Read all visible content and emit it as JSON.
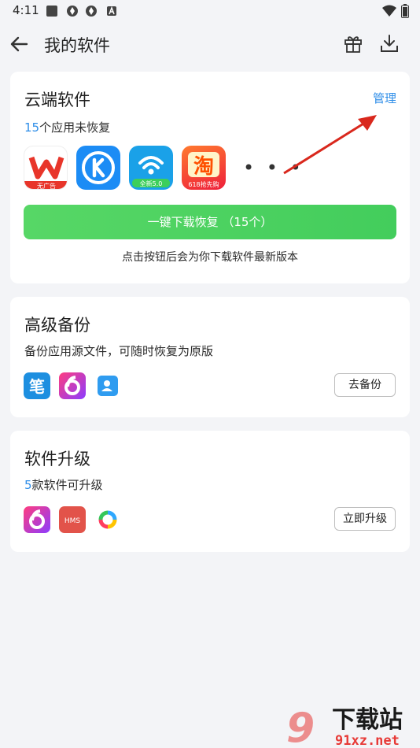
{
  "status_bar": {
    "time": "4:11"
  },
  "app_bar": {
    "title": "我的软件"
  },
  "cloud_section": {
    "title": "云端软件",
    "manage_label": "管理",
    "count": "15",
    "count_suffix": "个应用未恢复",
    "apps": [
      {
        "name": "WPS",
        "badge": "无广告"
      },
      {
        "name": "酷狗"
      },
      {
        "name": "WiFi万能钥匙",
        "badge": "全新5.0"
      },
      {
        "name": "淘宝",
        "badge": "618抢先购"
      }
    ],
    "more": "• • •",
    "restore_button": "一键下载恢复 （15个）",
    "hint": "点击按钮后会为你下载软件最新版本"
  },
  "backup_section": {
    "title": "高级备份",
    "description": "备份应用源文件，可随时恢复为原版",
    "button": "去备份"
  },
  "upgrade_section": {
    "title": "软件升级",
    "count": "5",
    "count_suffix": "款软件可升级",
    "hms_label": "HMS",
    "button": "立即升级"
  },
  "watermark": {
    "text": "下载站",
    "url": "91xz.net"
  },
  "colors": {
    "accent": "#2f8ee8",
    "green": "#4cd060",
    "background": "#f3f4f7"
  }
}
